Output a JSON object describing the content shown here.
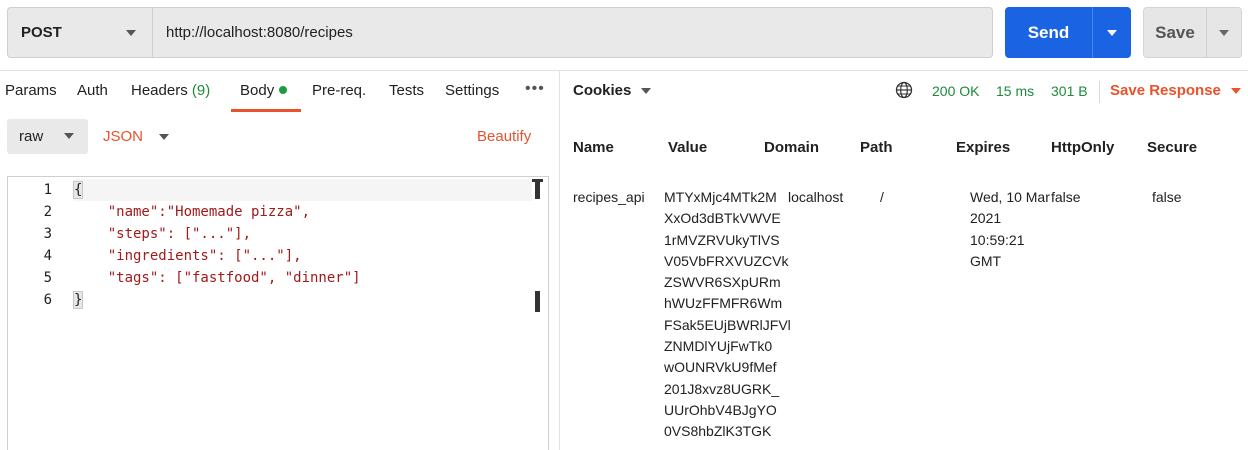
{
  "request": {
    "method": "POST",
    "url": "http://localhost:8080/recipes",
    "send_label": "Send",
    "save_label": "Save"
  },
  "request_tabs": {
    "params": "Params",
    "auth": "Auth",
    "headers": "Headers",
    "headers_count": "(9)",
    "body": "Body",
    "prereq": "Pre-req.",
    "tests": "Tests",
    "settings": "Settings",
    "more": "•••"
  },
  "body_options": {
    "mode": "raw",
    "language": "JSON",
    "beautify": "Beautify"
  },
  "editor": {
    "line_numbers": [
      "1",
      "2",
      "3",
      "4",
      "5",
      "6"
    ],
    "lines": [
      "{",
      "    \"name\":\"Homemade pizza\",",
      "    \"steps\": [\"...\"],",
      "    \"ingredients\": [\"...\"],",
      "    \"tags\": [\"fastfood\", \"dinner\"]",
      "}"
    ]
  },
  "response": {
    "tab": "Cookies",
    "status": "200 OK",
    "time": "15 ms",
    "size": "301 B",
    "save_response": "Save Response",
    "columns": [
      "Name",
      "Value",
      "Domain",
      "Path",
      "Expires",
      "HttpOnly",
      "Secure"
    ],
    "cookie": {
      "name": "recipes_api",
      "value_lines": [
        "MTYxMjc4MTk2M",
        "XxOd3dBTkVWVE",
        "1rMVZRVUkyTlVS",
        "V05VbFRXVUZCVk",
        "ZSWVR6SXpURm",
        "hWUzFFMFR6Wm",
        "FSak5EUjBWRlJFVl",
        "ZNMDlYUjFwTk0",
        "wOUNRVkU9fMef",
        "201J8xvz8UGRK_",
        "UUrOhbV4BJgYO",
        "0VS8hbZlK3TGK"
      ],
      "domain": "localhost",
      "path": "/",
      "expires_lines": [
        "Wed, 10 Mar",
        "2021",
        "10:59:21",
        "GMT"
      ],
      "httponly": "false",
      "secure": "false"
    }
  },
  "colors": {
    "send": "#1a63e3",
    "accent": "#e8532c",
    "success": "#1e8a3a"
  }
}
